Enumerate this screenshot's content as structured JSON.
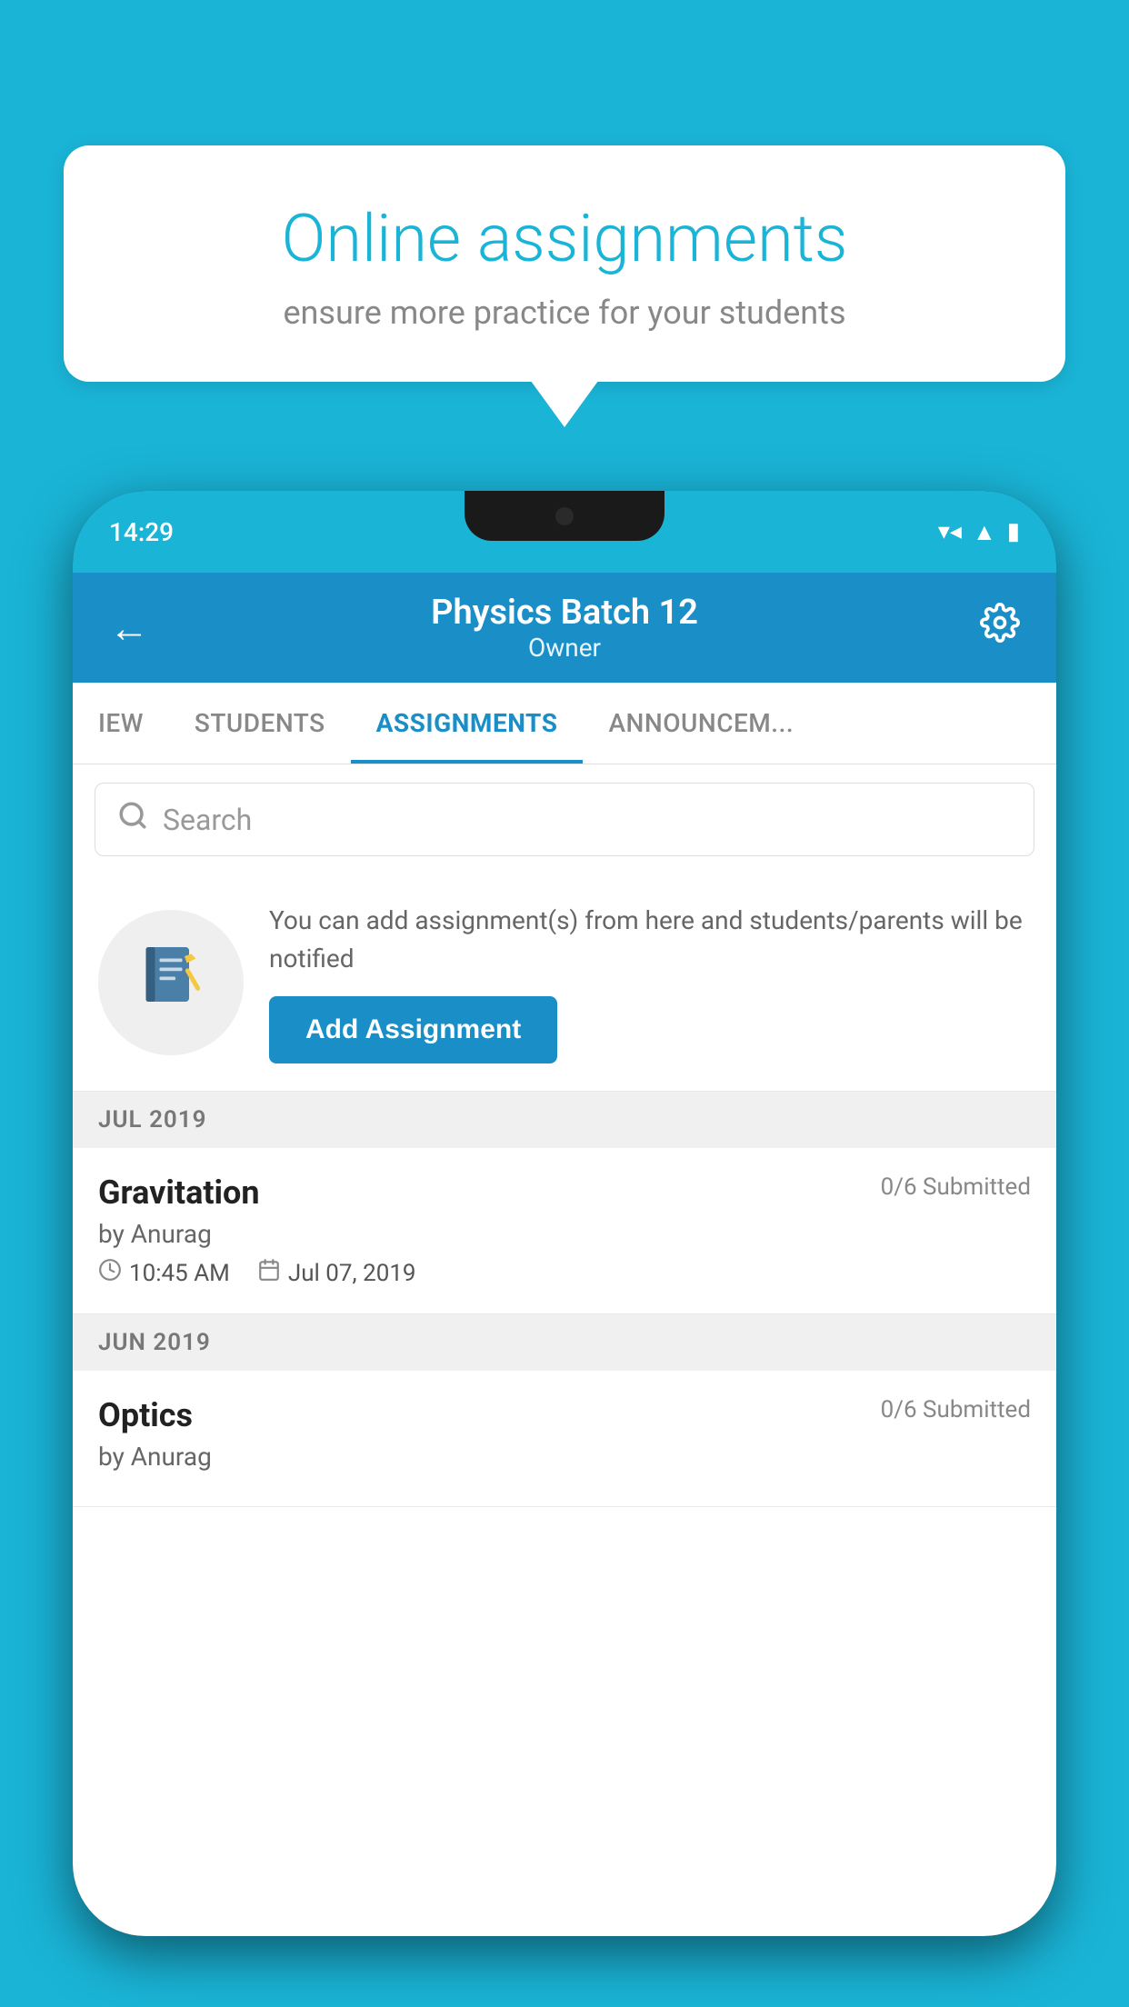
{
  "background_color": "#1ab4d7",
  "speech_bubble": {
    "title": "Online assignments",
    "subtitle": "ensure more practice for your students"
  },
  "phone": {
    "status_bar": {
      "time": "14:29",
      "icons": [
        "wifi",
        "signal",
        "battery"
      ]
    },
    "header": {
      "title": "Physics Batch 12",
      "subtitle": "Owner",
      "back_label": "←",
      "settings_label": "⚙"
    },
    "tabs": [
      {
        "label": "IEW",
        "active": false
      },
      {
        "label": "STUDENTS",
        "active": false
      },
      {
        "label": "ASSIGNMENTS",
        "active": true
      },
      {
        "label": "ANNOUNCEM...",
        "active": false
      }
    ],
    "search": {
      "placeholder": "Search"
    },
    "add_assignment_card": {
      "description": "You can add assignment(s) from here and students/parents will be notified",
      "button_label": "Add Assignment"
    },
    "sections": [
      {
        "header": "JUL 2019",
        "assignments": [
          {
            "name": "Gravitation",
            "submitted": "0/6 Submitted",
            "by": "by Anurag",
            "time": "10:45 AM",
            "date": "Jul 07, 2019"
          }
        ]
      },
      {
        "header": "JUN 2019",
        "assignments": [
          {
            "name": "Optics",
            "submitted": "0/6 Submitted",
            "by": "by Anurag",
            "time": "",
            "date": ""
          }
        ]
      }
    ]
  }
}
